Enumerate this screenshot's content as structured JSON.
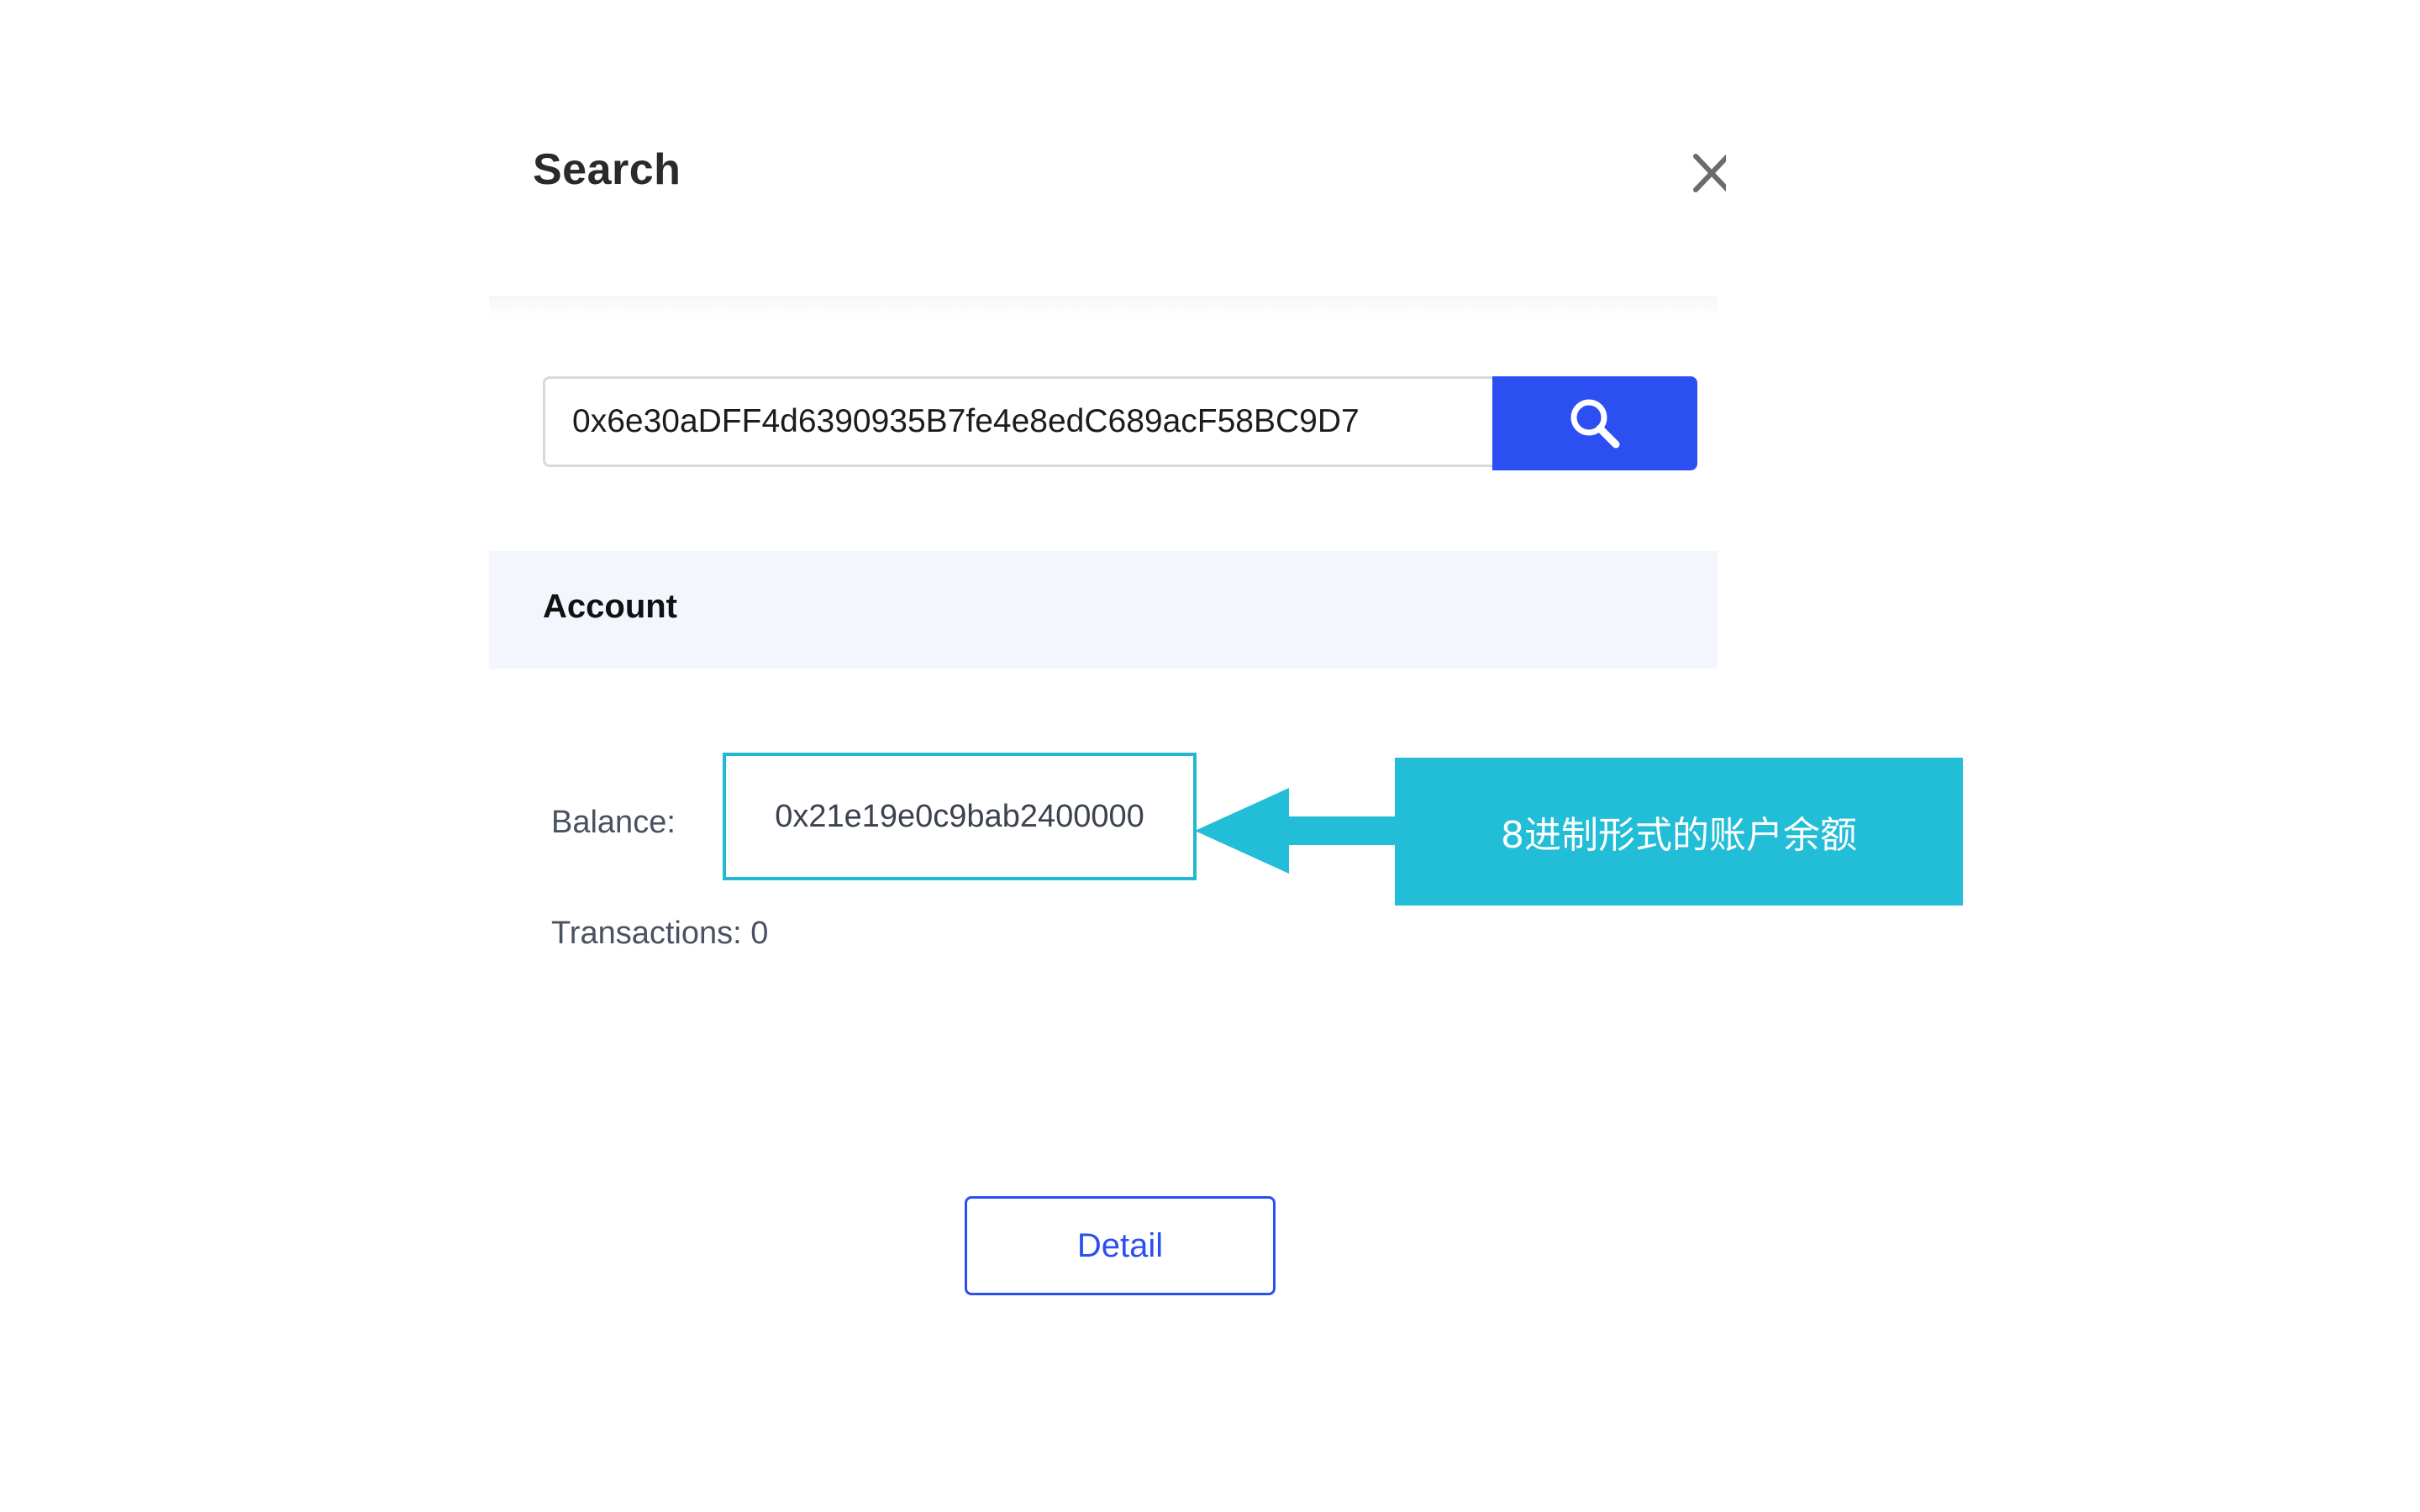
{
  "modal": {
    "title": "Search",
    "close_icon": "close-icon"
  },
  "search": {
    "value": "0x6e30aDFF4d6390935B7fe4e8edC689acF58BC9D7",
    "button_icon": "search-icon",
    "accent_color": "#2c4ff2"
  },
  "account": {
    "section_title": "Account",
    "balance_label": "Balance:",
    "balance_value": "0x21e19e0c9bab2400000",
    "transactions_text": "Transactions: 0"
  },
  "actions": {
    "detail_label": "Detail"
  },
  "annotation": {
    "callout_text": "8进制形式的账户余额",
    "arrow_icon": "left-arrow-icon",
    "color": "#22bdd6"
  }
}
